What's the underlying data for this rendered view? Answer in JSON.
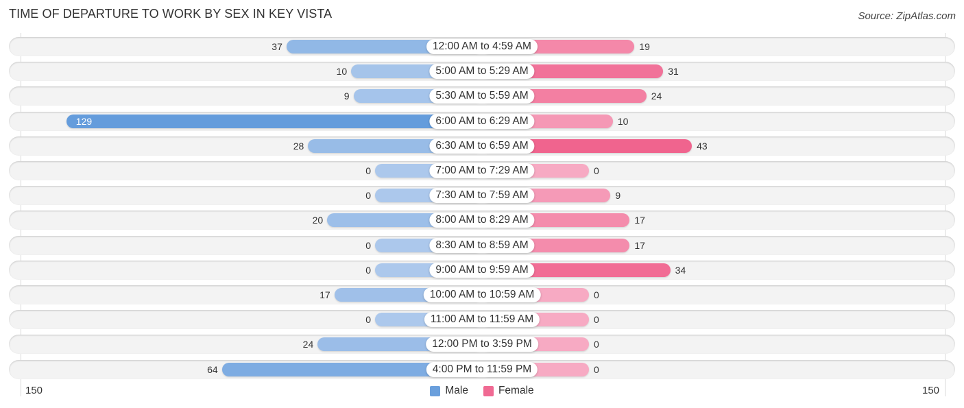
{
  "chart_data": {
    "type": "bar",
    "orientation": "horizontal-diverging",
    "title": "TIME OF DEPARTURE TO WORK BY SEX IN KEY VISTA",
    "source": "Source: ZipAtlas.com",
    "categories": [
      "12:00 AM to 4:59 AM",
      "5:00 AM to 5:29 AM",
      "5:30 AM to 5:59 AM",
      "6:00 AM to 6:29 AM",
      "6:30 AM to 6:59 AM",
      "7:00 AM to 7:29 AM",
      "7:30 AM to 7:59 AM",
      "8:00 AM to 8:29 AM",
      "8:30 AM to 8:59 AM",
      "9:00 AM to 9:59 AM",
      "10:00 AM to 10:59 AM",
      "11:00 AM to 11:59 AM",
      "12:00 PM to 3:59 PM",
      "4:00 PM to 11:59 PM"
    ],
    "series": [
      {
        "name": "Male",
        "color": "#6a9fdc",
        "values": [
          37,
          10,
          9,
          129,
          28,
          0,
          0,
          20,
          0,
          0,
          17,
          0,
          24,
          64
        ]
      },
      {
        "name": "Female",
        "color": "#f06a93",
        "values": [
          19,
          31,
          24,
          10,
          43,
          0,
          9,
          17,
          17,
          34,
          0,
          0,
          0,
          0
        ]
      }
    ],
    "axis": {
      "min_label": "150",
      "max_label": "150",
      "range": [
        -150,
        150
      ]
    },
    "legend": {
      "position": "bottom-center",
      "entries": [
        "Male",
        "Female"
      ]
    }
  }
}
